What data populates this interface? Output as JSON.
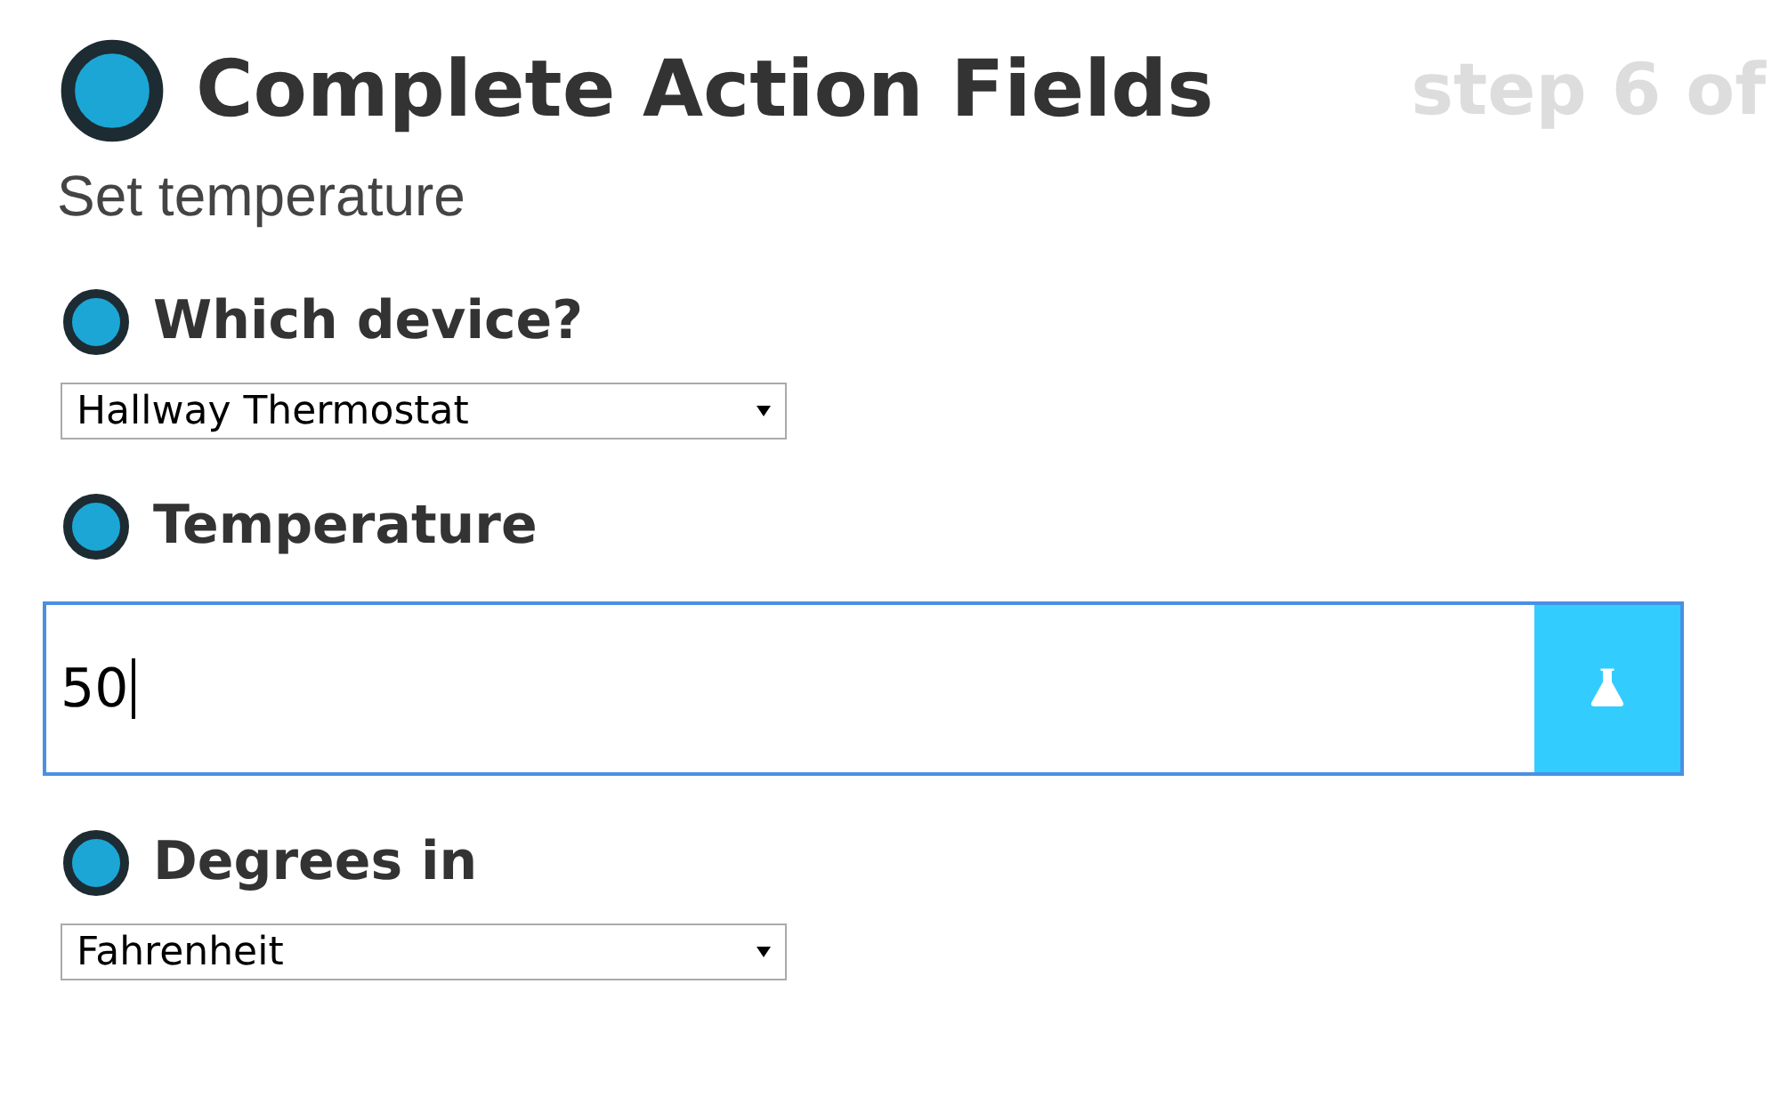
{
  "header": {
    "title": "Complete Action Fields",
    "step": "step 6 of"
  },
  "subtitle": "Set temperature",
  "fields": [
    {
      "kind": "select",
      "label": "Which device?",
      "value": "Hallway Thermostat"
    },
    {
      "kind": "text",
      "label": "Temperature",
      "value": "50"
    },
    {
      "kind": "select",
      "label": "Degrees in",
      "value": "Fahrenheit"
    }
  ]
}
